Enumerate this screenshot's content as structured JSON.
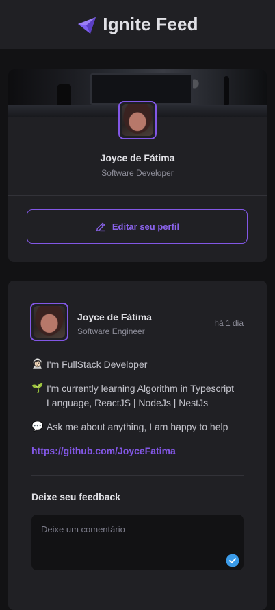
{
  "header": {
    "title": "Ignite Feed",
    "logo_icon": "ignite-logo-icon",
    "colors": {
      "background": "#202024",
      "accent": "#8257e5"
    }
  },
  "profile": {
    "name": "Joyce de Fátima",
    "role": "Software Developer",
    "edit_label": "Editar seu perfil",
    "edit_icon": "pencil-icon"
  },
  "post": {
    "author_name": "Joyce de Fátima",
    "author_role": "Software Engineer",
    "time": "há 1 dia",
    "lines": [
      {
        "emoji": "👩🏻‍🚀",
        "text": "I'm FullStack Developer"
      },
      {
        "emoji": "🌱",
        "text": "I'm currently learning Algorithm in Typescript Language, ReactJS | NodeJs | NestJs"
      },
      {
        "emoji": "💬",
        "text": "Ask me about anything, I am happy to help"
      }
    ],
    "link": "https://github.com/JoyceFatima",
    "feedback_title": "Deixe seu feedback",
    "comment_placeholder": "Deixe um comentário",
    "comment_value": ""
  }
}
